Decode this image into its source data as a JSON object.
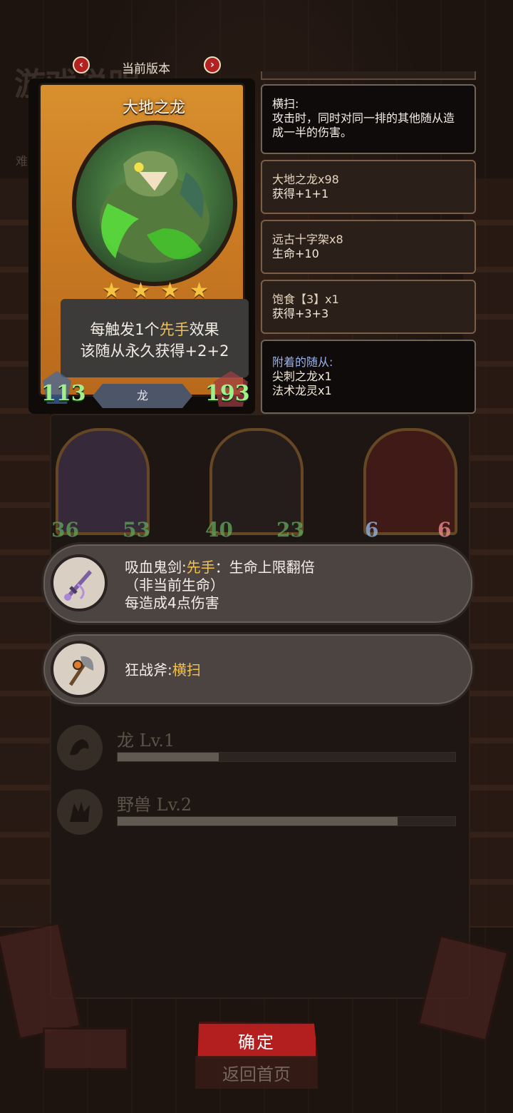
{
  "background": {
    "title": "游戏说明",
    "difficulty_label": "难"
  },
  "version": {
    "label": "当前版本"
  },
  "card": {
    "name": "大地之龙",
    "stars": 4,
    "star_glyph": "★",
    "description_pre": "每触发1个",
    "description_keyword": "先手",
    "description_mid": "效果",
    "description_line2": "该随从永久获得+2+2",
    "attack": "113",
    "health": "193",
    "tribe": "龙"
  },
  "keyword_info": {
    "title": "横扫:",
    "text": "攻击时，同时对同一排的其他随从造成一半的伤害。"
  },
  "buffs": [
    {
      "source": "大地之龙x98",
      "effect": "获得+1+1"
    },
    {
      "source": "远古十字架x8",
      "effect": "生命+10"
    },
    {
      "source": "饱食【3】x1",
      "effect": "获得+3+3"
    }
  ],
  "attached": {
    "header": "附着的随从:",
    "items": [
      "尖刺之龙x1",
      "法术龙灵x1"
    ]
  },
  "minions": [
    {
      "attack": "36",
      "health": "53"
    },
    {
      "attack": "40",
      "health": "23"
    },
    {
      "attack": "6",
      "health": "6"
    }
  ],
  "equipment": [
    {
      "name": "吸血鬼剑:",
      "keyword": "先手",
      "text_after": "：生命上限翻倍",
      "line2": "（非当前生命）",
      "line3": "每造成4点伤害"
    },
    {
      "name": "狂战斧:",
      "keyword": "横扫"
    }
  ],
  "tribes": [
    {
      "label": "龙 Lv.1",
      "progress": 0.3
    },
    {
      "label": "野兽 Lv.2",
      "progress": 0.83
    }
  ],
  "buttons": {
    "confirm": "确定",
    "home": "返回首页"
  },
  "colors": {
    "keyword_gold": "#f2c14e",
    "attack_green": "#9ff08a",
    "confirm_red": "#b31f1f"
  }
}
